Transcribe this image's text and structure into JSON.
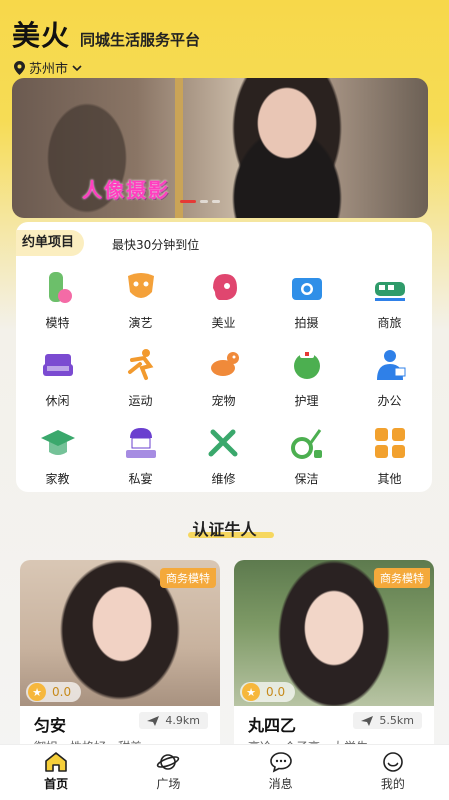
{
  "header": {
    "app_name": "美火",
    "slogan": "同城生活服务平台"
  },
  "location": {
    "city": "苏州市"
  },
  "banner": {
    "caption": "人像摄影"
  },
  "services": {
    "tag": "约单项目",
    "subtitle": "最快30分钟到位",
    "items": [
      {
        "label": "模特",
        "icon": "model-icon",
        "color": "#6cbf6a"
      },
      {
        "label": "演艺",
        "icon": "mask-icon",
        "color": "#f4a13a"
      },
      {
        "label": "美业",
        "icon": "beauty-icon",
        "color": "#e0466f"
      },
      {
        "label": "拍摄",
        "icon": "camera-icon",
        "color": "#2f8fe8"
      },
      {
        "label": "商旅",
        "icon": "train-icon",
        "color": "#2f9b6a"
      },
      {
        "label": "休闲",
        "icon": "sofa-icon",
        "color": "#7b4bd1"
      },
      {
        "label": "运动",
        "icon": "runner-icon",
        "color": "#f29a2e"
      },
      {
        "label": "宠物",
        "icon": "pet-icon",
        "color": "#f08a3a"
      },
      {
        "label": "护理",
        "icon": "nurse-icon",
        "color": "#4caf50"
      },
      {
        "label": "办公",
        "icon": "office-icon",
        "color": "#2f80e8"
      },
      {
        "label": "家教",
        "icon": "graduation-icon",
        "color": "#3aa86c"
      },
      {
        "label": "私宴",
        "icon": "chef-icon",
        "color": "#6a3fcf"
      },
      {
        "label": "维修",
        "icon": "tools-icon",
        "color": "#3aa86c"
      },
      {
        "label": "保洁",
        "icon": "vacuum-icon",
        "color": "#4caf50"
      },
      {
        "label": "其他",
        "icon": "grid-icon",
        "color": "#f2a12e"
      }
    ]
  },
  "section": {
    "title": "认证牛人"
  },
  "providers": [
    {
      "badge": "商务模特",
      "rating": "0.0",
      "name": "匀安",
      "distance": "4.9km",
      "desc": "御姐，性格好，甜美"
    },
    {
      "badge": "商务模特",
      "rating": "0.0",
      "name": "丸四乙",
      "distance": "5.5km",
      "desc": "高冷，个子高，大学生"
    }
  ],
  "tabbar": {
    "items": [
      {
        "label": "首页",
        "icon": "home-icon"
      },
      {
        "label": "广场",
        "icon": "planet-icon"
      },
      {
        "label": "消息",
        "icon": "chat-icon"
      },
      {
        "label": "我的",
        "icon": "smile-icon"
      }
    ]
  }
}
